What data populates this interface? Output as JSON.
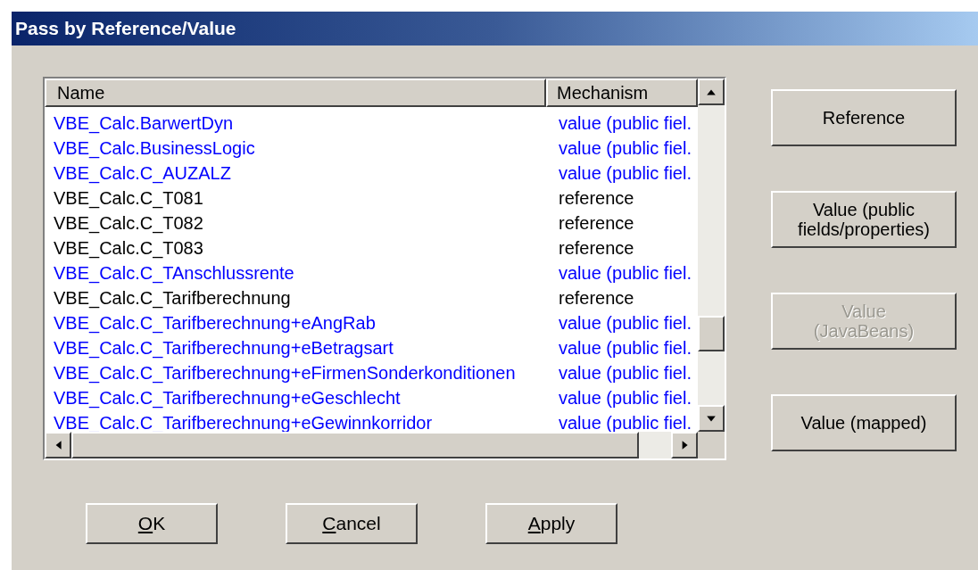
{
  "window": {
    "title": "Pass by Reference/Value"
  },
  "list": {
    "columns": [
      "Name",
      "Mechanism"
    ],
    "rows": [
      {
        "name": "VBE_Calc.BarwertDyn",
        "mechanism": "value (public fiel.",
        "color": "#0000ff"
      },
      {
        "name": "VBE_Calc.BusinessLogic",
        "mechanism": "value (public fiel.",
        "color": "#0000ff"
      },
      {
        "name": "VBE_Calc.C_AUZALZ",
        "mechanism": "value (public fiel.",
        "color": "#0000ff"
      },
      {
        "name": "VBE_Calc.C_T081",
        "mechanism": "reference",
        "color": "#000000"
      },
      {
        "name": "VBE_Calc.C_T082",
        "mechanism": "reference",
        "color": "#000000"
      },
      {
        "name": "VBE_Calc.C_T083",
        "mechanism": "reference",
        "color": "#000000"
      },
      {
        "name": "VBE_Calc.C_TAnschlussrente",
        "mechanism": "value (public fiel.",
        "color": "#0000ff"
      },
      {
        "name": "VBE_Calc.C_Tarifberechnung",
        "mechanism": "reference",
        "color": "#000000"
      },
      {
        "name": "VBE_Calc.C_Tarifberechnung+eAngRab",
        "mechanism": "value (public fiel.",
        "color": "#0000ff"
      },
      {
        "name": "VBE_Calc.C_Tarifberechnung+eBetragsart",
        "mechanism": "value (public fiel.",
        "color": "#0000ff"
      },
      {
        "name": "VBE_Calc.C_Tarifberechnung+eFirmenSonderkonditionen",
        "mechanism": "value (public fiel.",
        "color": "#0000ff"
      },
      {
        "name": "VBE_Calc.C_Tarifberechnung+eGeschlecht",
        "mechanism": "value (public fiel.",
        "color": "#0000ff"
      },
      {
        "name": "VBE_Calc.C_Tarifberechnung+eGewinnkorridor",
        "mechanism": "value (public fiel.",
        "color": "#0000ff"
      }
    ]
  },
  "side_buttons": [
    {
      "label": "Reference",
      "disabled": false
    },
    {
      "label": "Value (public\nfields/properties)",
      "disabled": false
    },
    {
      "label": "Value\n(JavaBeans)",
      "disabled": true
    },
    {
      "label": "Value (mapped)",
      "disabled": false
    }
  ],
  "buttons": [
    {
      "access_key": "O",
      "rest": "K"
    },
    {
      "access_key": "C",
      "rest": "ancel"
    },
    {
      "access_key": "A",
      "rest": "pply"
    }
  ]
}
